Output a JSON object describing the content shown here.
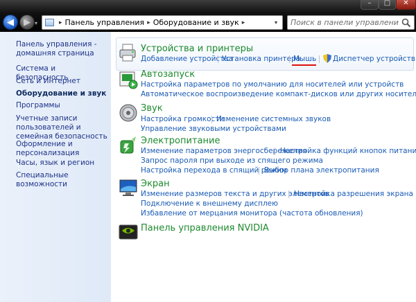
{
  "window": {
    "minimize_glyph": "–",
    "maximize_glyph": "□",
    "close_glyph": "✕"
  },
  "toolbar": {
    "back_glyph": "◀",
    "forward_glyph": "▶",
    "dropdown_glyph": "▾",
    "refresh_glyph": "⟳"
  },
  "address": {
    "breadcrumbs": [
      "Панель управления",
      "Оборудование и звук"
    ],
    "separator": "▸"
  },
  "search": {
    "placeholder": "Поиск в панели управления"
  },
  "sidebar": {
    "items": [
      "Панель управления - домашняя страница",
      "Система и безопасность",
      "Сеть и Интернет",
      "Оборудование и звук",
      "Программы",
      "Учетные записи пользователей и семейная безопасность",
      "Оформление и персонализация",
      "Часы, язык и регион",
      "Специальные возможности"
    ],
    "active_index": 3
  },
  "categories": {
    "devices": {
      "title": "Устройства и принтеры",
      "links": [
        "Добавление устройства",
        "Установка принтера",
        "Мышь",
        "Диспетчер устройств"
      ]
    },
    "autoplay": {
      "title": "Автозапуск",
      "links": [
        "Настройка параметров по умолчанию для носителей или устройств",
        "Автоматическое воспроизведение компакт-дисков или других носителей"
      ]
    },
    "sound": {
      "title": "Звук",
      "links": [
        "Настройка громкости",
        "Изменение системных звуков",
        "Управление звуковыми устройствами"
      ]
    },
    "power": {
      "title": "Электропитание",
      "links": [
        "Изменение параметров энергосбережения",
        "Настройка функций кнопок питания",
        "Запрос пароля при выходе из спящего режима",
        "Настройка перехода в спящий режим",
        "Выбор плана электропитания"
      ]
    },
    "display": {
      "title": "Экран",
      "links": [
        "Изменение размеров текста и других элементов",
        "Настройка разрешения экрана",
        "Подключение к внешнему дисплею",
        "Избавление от мерцания монитора (частота обновления)"
      ]
    },
    "nvidia": {
      "title": "Панель управления NVIDIA"
    }
  },
  "colors": {
    "link": "#1a5bb5",
    "category_title": "#1e8a2f",
    "sidebar_bg": "#e3ecf8",
    "highlight_underline": "#dd1111"
  }
}
